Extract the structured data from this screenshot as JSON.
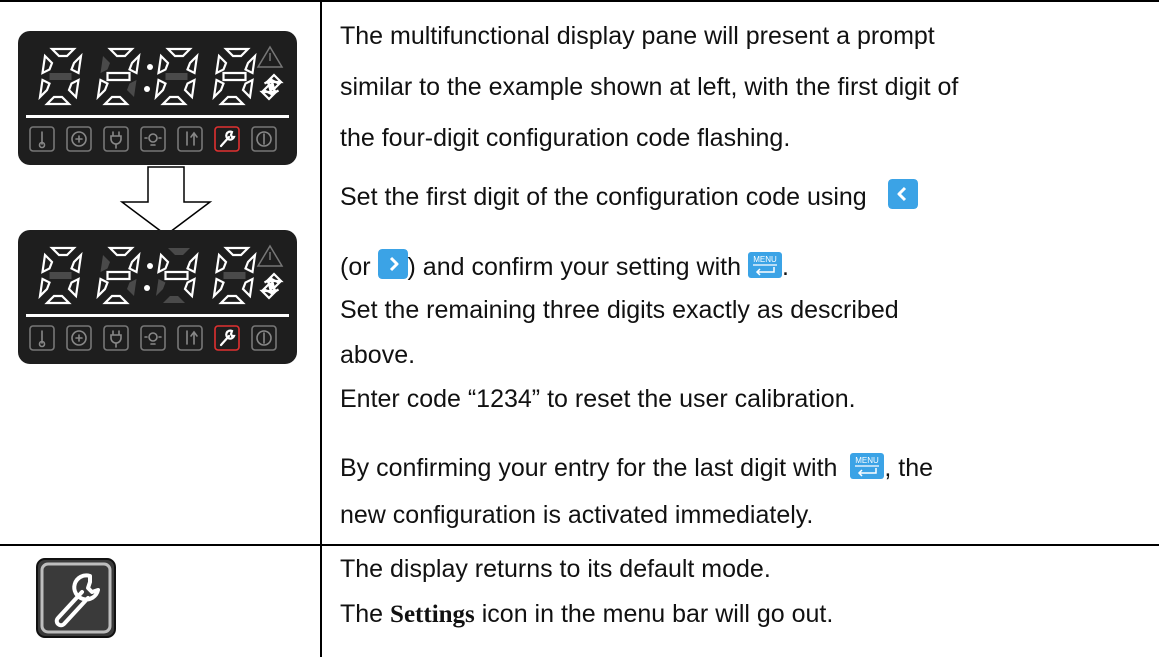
{
  "section1": {
    "display_top": {
      "digits": [
        "0",
        "2",
        "0",
        "8"
      ]
    },
    "display_bottom": {
      "digits": [
        "0",
        "2",
        "4",
        "0"
      ]
    },
    "paragraph1": [
      "The multifunctional display pane will present a prompt",
      "similar to the example shown at left, with the first digit of",
      "the four-digit configuration code flashing."
    ],
    "set_first_pre": "Set the first digit of the configuration code using",
    "or_open": "(or",
    "confirm_text": ") and confirm your setting with",
    "period": ".",
    "remaining": [
      "Set the remaining three digits exactly as described",
      "above."
    ],
    "enter_code": "Enter code “1234” to reset the user calibration.",
    "confirming_pre": "By confirming your entry for the last digit with",
    "confirming_post": ", the",
    "activated": "new configuration is activated immediately.",
    "menu_button_label": "MENU"
  },
  "section2": {
    "line1": "The display returns to its default mode.",
    "line2_pre": "The",
    "line2_bold": "Settings",
    "line2_post": "icon in the menu bar will go out."
  },
  "colors": {
    "panel_bg": "#1e1e1e",
    "segment_on": "#ffffff",
    "segment_dim": "#4a4a4a",
    "accent_blue": "#3ba3e6",
    "wrench_red": "#e03030"
  },
  "icons": [
    "thermometer-icon",
    "target-icon",
    "plug-icon",
    "lamp-icon",
    "thermo-arrow-icon",
    "wrench-icon",
    "power-icon",
    "warning-icon",
    "left-arrow-icon",
    "right-arrow-icon",
    "menu-enter-icon"
  ]
}
